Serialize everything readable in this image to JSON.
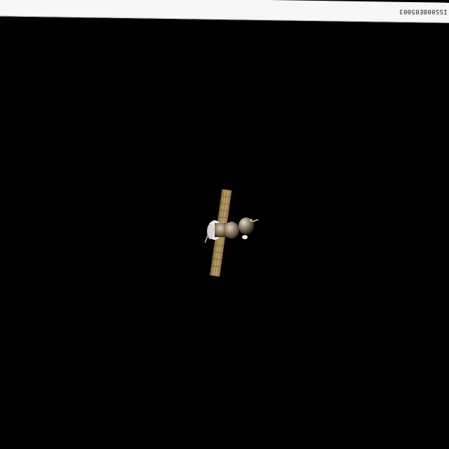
{
  "photo": {
    "frame_id": "ISS008E05003"
  },
  "colors": {
    "space": "#000000",
    "strip": "#f7f7f7",
    "solar_panel": "#b89a62",
    "hull": "#8b7760"
  },
  "subject_icon": "spacecraft-icon"
}
